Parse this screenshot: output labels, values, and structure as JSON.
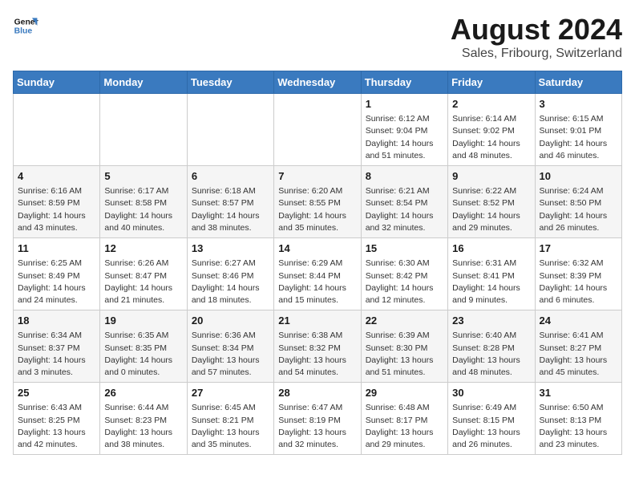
{
  "logo": {
    "line1": "General",
    "line2": "Blue"
  },
  "header": {
    "title": "August 2024",
    "subtitle": "Sales, Fribourg, Switzerland"
  },
  "weekdays": [
    "Sunday",
    "Monday",
    "Tuesday",
    "Wednesday",
    "Thursday",
    "Friday",
    "Saturday"
  ],
  "weeks": [
    [
      {
        "day": "",
        "info": ""
      },
      {
        "day": "",
        "info": ""
      },
      {
        "day": "",
        "info": ""
      },
      {
        "day": "",
        "info": ""
      },
      {
        "day": "1",
        "info": "Sunrise: 6:12 AM\nSunset: 9:04 PM\nDaylight: 14 hours and 51 minutes."
      },
      {
        "day": "2",
        "info": "Sunrise: 6:14 AM\nSunset: 9:02 PM\nDaylight: 14 hours and 48 minutes."
      },
      {
        "day": "3",
        "info": "Sunrise: 6:15 AM\nSunset: 9:01 PM\nDaylight: 14 hours and 46 minutes."
      }
    ],
    [
      {
        "day": "4",
        "info": "Sunrise: 6:16 AM\nSunset: 8:59 PM\nDaylight: 14 hours and 43 minutes."
      },
      {
        "day": "5",
        "info": "Sunrise: 6:17 AM\nSunset: 8:58 PM\nDaylight: 14 hours and 40 minutes."
      },
      {
        "day": "6",
        "info": "Sunrise: 6:18 AM\nSunset: 8:57 PM\nDaylight: 14 hours and 38 minutes."
      },
      {
        "day": "7",
        "info": "Sunrise: 6:20 AM\nSunset: 8:55 PM\nDaylight: 14 hours and 35 minutes."
      },
      {
        "day": "8",
        "info": "Sunrise: 6:21 AM\nSunset: 8:54 PM\nDaylight: 14 hours and 32 minutes."
      },
      {
        "day": "9",
        "info": "Sunrise: 6:22 AM\nSunset: 8:52 PM\nDaylight: 14 hours and 29 minutes."
      },
      {
        "day": "10",
        "info": "Sunrise: 6:24 AM\nSunset: 8:50 PM\nDaylight: 14 hours and 26 minutes."
      }
    ],
    [
      {
        "day": "11",
        "info": "Sunrise: 6:25 AM\nSunset: 8:49 PM\nDaylight: 14 hours and 24 minutes."
      },
      {
        "day": "12",
        "info": "Sunrise: 6:26 AM\nSunset: 8:47 PM\nDaylight: 14 hours and 21 minutes."
      },
      {
        "day": "13",
        "info": "Sunrise: 6:27 AM\nSunset: 8:46 PM\nDaylight: 14 hours and 18 minutes."
      },
      {
        "day": "14",
        "info": "Sunrise: 6:29 AM\nSunset: 8:44 PM\nDaylight: 14 hours and 15 minutes."
      },
      {
        "day": "15",
        "info": "Sunrise: 6:30 AM\nSunset: 8:42 PM\nDaylight: 14 hours and 12 minutes."
      },
      {
        "day": "16",
        "info": "Sunrise: 6:31 AM\nSunset: 8:41 PM\nDaylight: 14 hours and 9 minutes."
      },
      {
        "day": "17",
        "info": "Sunrise: 6:32 AM\nSunset: 8:39 PM\nDaylight: 14 hours and 6 minutes."
      }
    ],
    [
      {
        "day": "18",
        "info": "Sunrise: 6:34 AM\nSunset: 8:37 PM\nDaylight: 14 hours and 3 minutes."
      },
      {
        "day": "19",
        "info": "Sunrise: 6:35 AM\nSunset: 8:35 PM\nDaylight: 14 hours and 0 minutes."
      },
      {
        "day": "20",
        "info": "Sunrise: 6:36 AM\nSunset: 8:34 PM\nDaylight: 13 hours and 57 minutes."
      },
      {
        "day": "21",
        "info": "Sunrise: 6:38 AM\nSunset: 8:32 PM\nDaylight: 13 hours and 54 minutes."
      },
      {
        "day": "22",
        "info": "Sunrise: 6:39 AM\nSunset: 8:30 PM\nDaylight: 13 hours and 51 minutes."
      },
      {
        "day": "23",
        "info": "Sunrise: 6:40 AM\nSunset: 8:28 PM\nDaylight: 13 hours and 48 minutes."
      },
      {
        "day": "24",
        "info": "Sunrise: 6:41 AM\nSunset: 8:27 PM\nDaylight: 13 hours and 45 minutes."
      }
    ],
    [
      {
        "day": "25",
        "info": "Sunrise: 6:43 AM\nSunset: 8:25 PM\nDaylight: 13 hours and 42 minutes."
      },
      {
        "day": "26",
        "info": "Sunrise: 6:44 AM\nSunset: 8:23 PM\nDaylight: 13 hours and 38 minutes."
      },
      {
        "day": "27",
        "info": "Sunrise: 6:45 AM\nSunset: 8:21 PM\nDaylight: 13 hours and 35 minutes."
      },
      {
        "day": "28",
        "info": "Sunrise: 6:47 AM\nSunset: 8:19 PM\nDaylight: 13 hours and 32 minutes."
      },
      {
        "day": "29",
        "info": "Sunrise: 6:48 AM\nSunset: 8:17 PM\nDaylight: 13 hours and 29 minutes."
      },
      {
        "day": "30",
        "info": "Sunrise: 6:49 AM\nSunset: 8:15 PM\nDaylight: 13 hours and 26 minutes."
      },
      {
        "day": "31",
        "info": "Sunrise: 6:50 AM\nSunset: 8:13 PM\nDaylight: 13 hours and 23 minutes."
      }
    ]
  ]
}
